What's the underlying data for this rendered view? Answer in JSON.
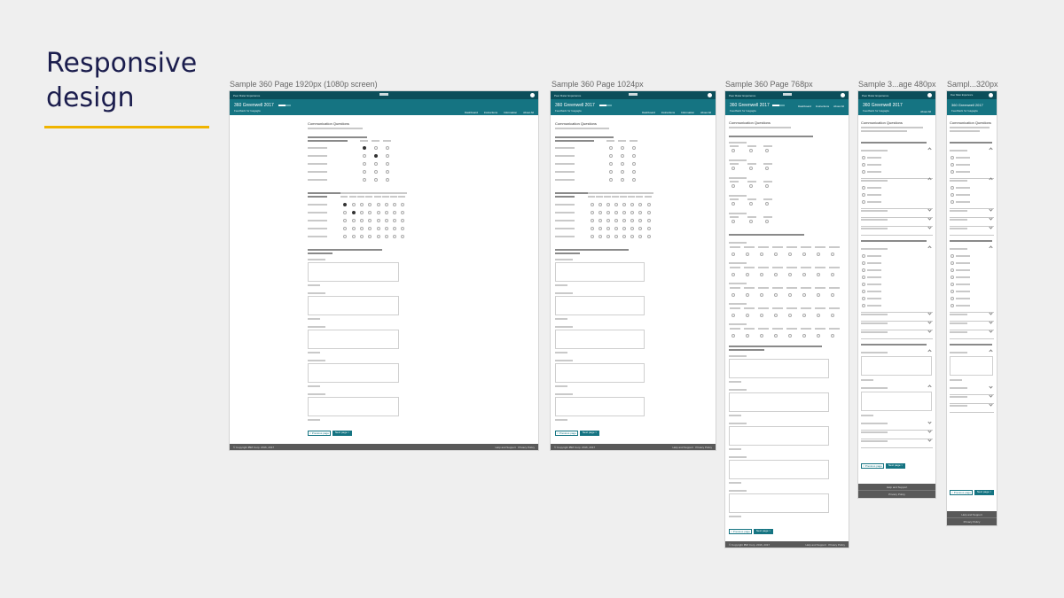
{
  "slide": {
    "title_line1": "Responsive",
    "title_line2": "design"
  },
  "captions": [
    "Sample 360 Page 1920px (1080p screen)",
    "Sample 360 Page 1024px",
    "Sample 360 Page 768px",
    "Sample 3...age 480px",
    "Sampl...320px"
  ],
  "page": {
    "app_name": "Peer Rater Experience",
    "header_title": "360 Greenwell 2017",
    "header_subtitle": "Feedback for Isagagla",
    "nav": [
      "Dashboard",
      "Instructions",
      "Information",
      "About All"
    ],
    "section_title": "Communication Questions",
    "prev_button": "< Previous page",
    "next_button": "Next page >",
    "footer_left": "© Copyright IBM Corp. 2016, 2017",
    "footer_help": "Help and Support",
    "footer_privacy": "Privacy Policy"
  },
  "colors": {
    "teal_dark": "#0c4e5a",
    "teal": "#157482",
    "accent": "#f0b400",
    "title": "#1b1d4d"
  }
}
